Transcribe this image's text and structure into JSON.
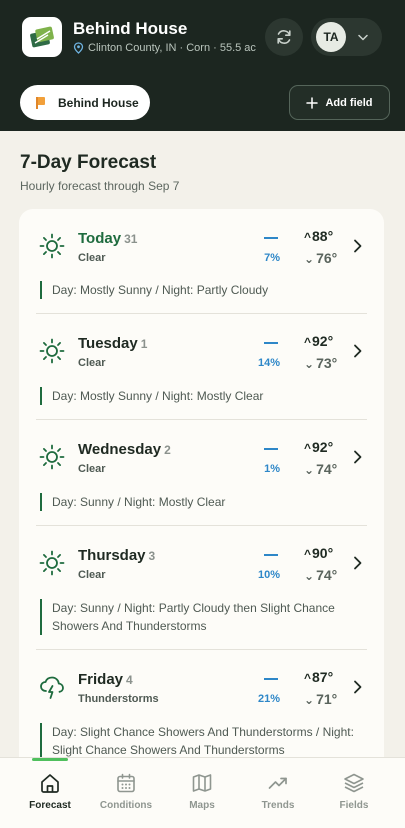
{
  "header": {
    "title": "Behind House",
    "subtitle": "Clinton County, IN · Corn · 55.5 ac",
    "avatar_initials": "TA",
    "field_chip_label": "Behind House",
    "add_field_label": "Add field"
  },
  "forecast": {
    "title": "7-Day Forecast",
    "subtitle": "Hourly forecast through Sep 7",
    "days": [
      {
        "name": "Today",
        "num": "31",
        "condition": "Clear",
        "precip": "7%",
        "hi": "88°",
        "lo": "76°",
        "detail": "Day: Mostly Sunny / Night: Partly Cloudy",
        "icon": "sun-icon"
      },
      {
        "name": "Tuesday",
        "num": "1",
        "condition": "Clear",
        "precip": "14%",
        "hi": "92°",
        "lo": "73°",
        "detail": "Day: Mostly Sunny / Night: Mostly Clear",
        "icon": "sun-icon"
      },
      {
        "name": "Wednesday",
        "num": "2",
        "condition": "Clear",
        "precip": "1%",
        "hi": "92°",
        "lo": "74°",
        "detail": "Day: Sunny / Night: Mostly Clear",
        "icon": "sun-icon"
      },
      {
        "name": "Thursday",
        "num": "3",
        "condition": "Clear",
        "precip": "10%",
        "hi": "90°",
        "lo": "74°",
        "detail": "Day: Sunny / Night: Partly Cloudy then Slight Chance Showers And Thunderstorms",
        "icon": "sun-icon"
      },
      {
        "name": "Friday",
        "num": "4",
        "condition": "Thunderstorms",
        "precip": "21%",
        "hi": "87°",
        "lo": "71°",
        "detail": "Day: Slight Chance Showers And Thunderstorms / Night: Slight Chance Showers And Thunderstorms",
        "icon": "thunderstorm-icon"
      }
    ]
  },
  "nav": {
    "forecast": "Forecast",
    "conditions": "Conditions",
    "maps": "Maps",
    "trends": "Trends",
    "fields": "Fields"
  },
  "colors": {
    "header_bg": "#1c2620",
    "accent_green": "#1e6b3e",
    "precip_blue": "#2e87c8",
    "nav_active_bar": "#4fbf5d"
  }
}
